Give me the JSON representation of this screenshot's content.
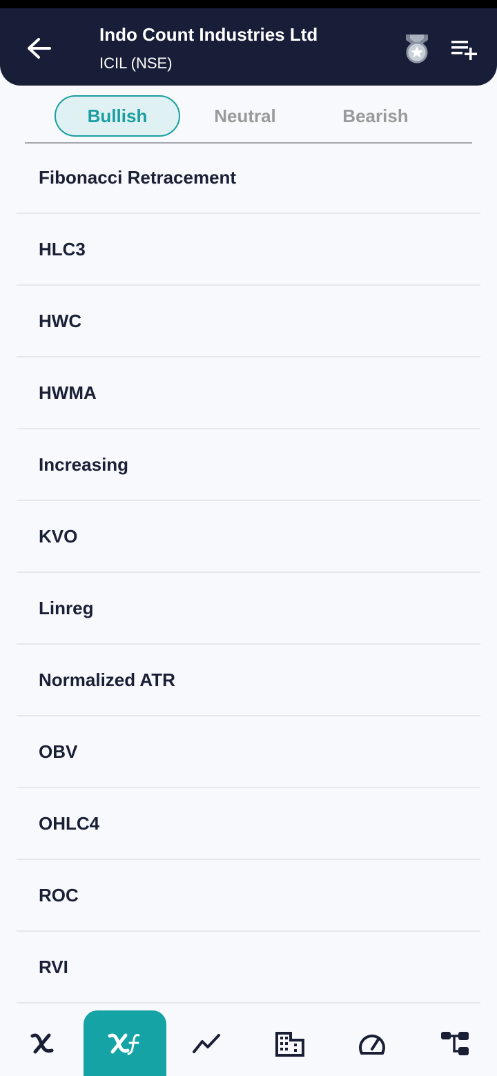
{
  "header": {
    "title": "Indo Count Industries Ltd",
    "subtitle": "ICIL (NSE)",
    "back_icon": "arrow-left-icon",
    "medal_icon": "medal-star-icon",
    "watchlist_icon": "playlist-add-icon"
  },
  "tabs": [
    {
      "label": "Bullish",
      "active": true
    },
    {
      "label": "Neutral",
      "active": false
    },
    {
      "label": "Bearish",
      "active": false
    }
  ],
  "indicators": [
    "Fibonacci Retracement",
    "HLC3",
    "HWC",
    "HWMA",
    "Increasing",
    "KVO",
    "Linreg",
    "Normalized ATR",
    "OBV",
    "OHLC4",
    "ROC",
    "RVI"
  ],
  "bottom_nav": [
    {
      "icon": "chi-icon",
      "active": false
    },
    {
      "icon": "chi-f-icon",
      "active": true
    },
    {
      "icon": "trend-chart-icon",
      "active": false
    },
    {
      "icon": "building-icon",
      "active": false
    },
    {
      "icon": "speedometer-icon",
      "active": false
    },
    {
      "icon": "hierarchy-icon",
      "active": false
    }
  ],
  "colors": {
    "header_bg": "#191e38",
    "accent": "#16a3a5",
    "active_tab_bg": "#e0f1f3",
    "text_dark": "#1a1f35",
    "inactive_tab": "#9a9a9a"
  }
}
